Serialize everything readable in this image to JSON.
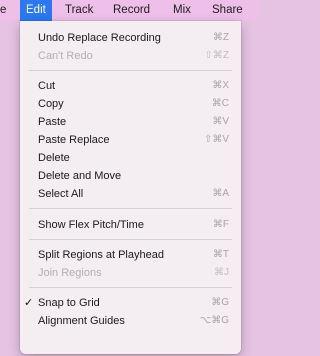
{
  "menubar": [
    "e",
    "Edit",
    "Track",
    "Record",
    "Mix",
    "Share"
  ],
  "menu": {
    "undo": {
      "label": "Undo Replace Recording",
      "shortcut": "⌘Z"
    },
    "redo": {
      "label": "Can't Redo",
      "shortcut": "⇧⌘Z"
    },
    "cut": {
      "label": "Cut",
      "shortcut": "⌘X"
    },
    "copy": {
      "label": "Copy",
      "shortcut": "⌘C"
    },
    "paste": {
      "label": "Paste",
      "shortcut": "⌘V"
    },
    "paste_replace": {
      "label": "Paste Replace",
      "shortcut": "⇧⌘V"
    },
    "delete": {
      "label": "Delete"
    },
    "delete_move": {
      "label": "Delete and Move"
    },
    "select_all": {
      "label": "Select All",
      "shortcut": "⌘A"
    },
    "flex": {
      "label": "Show Flex Pitch/Time",
      "shortcut": "⌘F"
    },
    "split": {
      "label": "Split Regions at Playhead",
      "shortcut": "⌘T"
    },
    "join": {
      "label": "Join Regions",
      "shortcut": "⌘J"
    },
    "snap": {
      "label": "Snap to Grid",
      "shortcut": "⌘G",
      "checkmark": "✓"
    },
    "guides": {
      "label": "Alignment Guides",
      "shortcut": "⌥⌘G"
    }
  }
}
